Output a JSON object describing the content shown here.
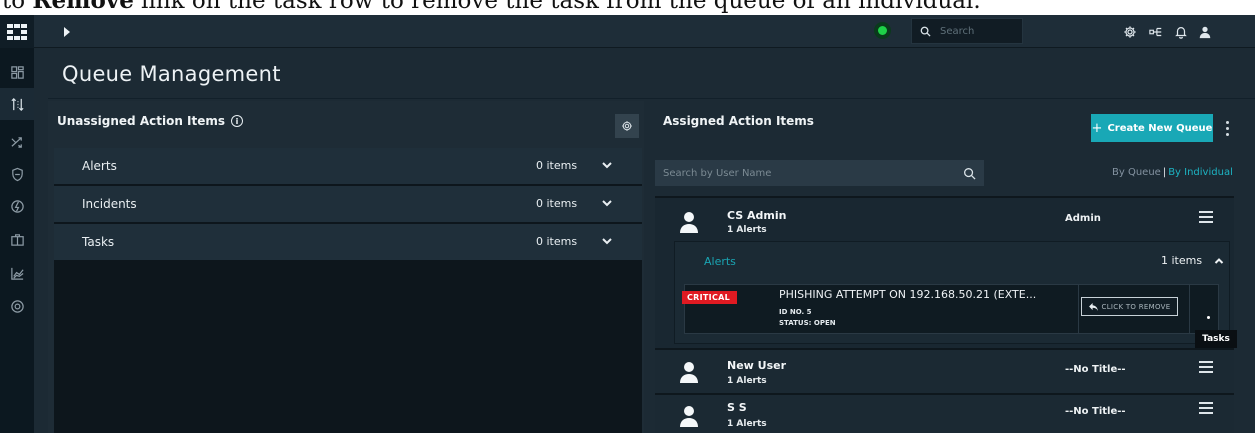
{
  "caption": {
    "prefix": "to ",
    "bold": "Remove",
    "suffix": " link on the task row to remove the task from the queue of an individual."
  },
  "topbar": {
    "search_placeholder": "Search",
    "status_color": "#1ed148"
  },
  "rail": {
    "icons": [
      "logo-icon",
      "dashboard-icon",
      "queue-icon",
      "shuffle-icon",
      "shield-icon",
      "bolt-icon",
      "briefcase-icon",
      "chart-icon",
      "settings-circle-icon"
    ],
    "active": "queue-icon"
  },
  "page": {
    "title": "Queue Management"
  },
  "unassigned": {
    "title": "Unassigned Action Items",
    "info_glyph": "i",
    "rows": [
      {
        "label": "Alerts",
        "count": "0 items"
      },
      {
        "label": "Incidents",
        "count": "0 items"
      },
      {
        "label": "Tasks",
        "count": "0 items"
      }
    ]
  },
  "assigned": {
    "title": "Assigned Action Items",
    "create_button": "Create New Queue",
    "create_plus": "+",
    "search_placeholder": "Search by User Name",
    "toggle": {
      "by_queue": "By Queue",
      "separator": "|",
      "by_individual": "By Individual"
    },
    "users": [
      {
        "name": "CS Admin",
        "summary": "1 Alerts",
        "role": "Admin",
        "section": {
          "label": "Alerts",
          "count": "1 items",
          "task": {
            "severity": "CRITICAL",
            "title": "PHISHING ATTEMPT ON 192.168.50.21 (EXTE...",
            "id": "ID NO. 5",
            "status": "STATUS: OPEN",
            "remove_label": "CLICK TO REMOVE"
          }
        }
      },
      {
        "name": "New User",
        "summary": "1 Alerts",
        "role": "--No Title--"
      },
      {
        "name": "S S",
        "summary": "1 Alerts",
        "role": "--No Title--"
      }
    ],
    "tooltip": "Tasks"
  },
  "colors": {
    "accent": "#19a8b6",
    "critical": "#e01a22",
    "background": "#1c2a34"
  }
}
